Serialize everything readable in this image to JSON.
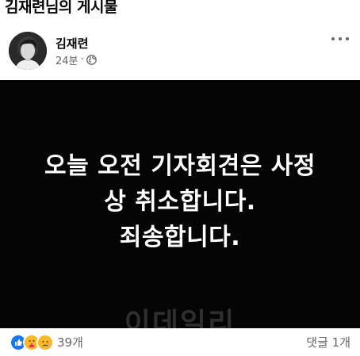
{
  "page_title": "김재련님의 게시물",
  "post": {
    "author": "김재련",
    "time": "24분",
    "separator": "·",
    "audience_icon": "globe-icon",
    "menu_icon": "more-options-icon",
    "image": {
      "lines": [
        "오늘 오전 기자회견은 사정",
        "상 취소합니다.",
        "죄송합니다."
      ],
      "watermark": "이데일리",
      "background": "#050505",
      "text_color": "#ffffff"
    },
    "reactions": {
      "icons": [
        "like-icon",
        "care-icon",
        "sad-icon"
      ],
      "count": "39개"
    },
    "comments": "댓글 1개"
  },
  "colors": {
    "like": "#1877f2",
    "emoji": "#f7b928",
    "muted_text": "#65676b"
  }
}
